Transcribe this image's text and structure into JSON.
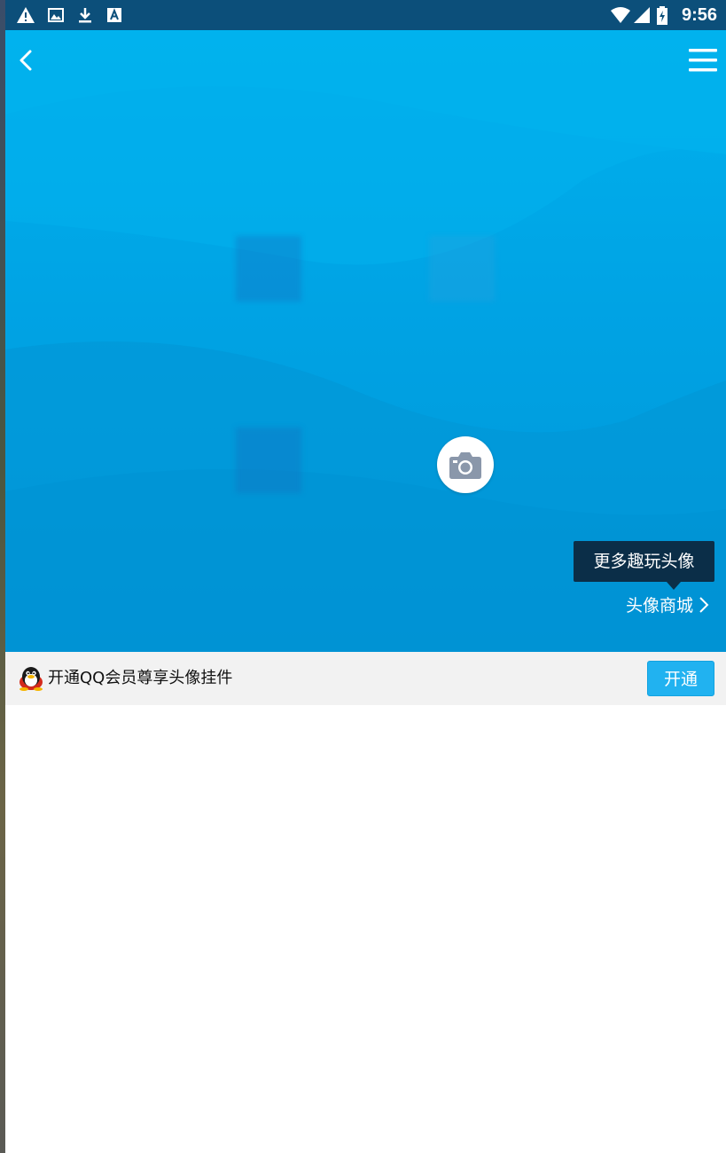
{
  "status_bar": {
    "icons_left": [
      "warning-icon",
      "image-icon",
      "download-icon",
      "font-icon"
    ],
    "icons_right": [
      "wifi-icon",
      "signal-icon",
      "battery-charging-icon"
    ],
    "time": "9:56"
  },
  "header": {
    "back_icon": "chevron-left-icon",
    "menu_icon": "menu-icon"
  },
  "hero": {
    "camera_icon": "camera-icon",
    "tooltip_text": "更多趣玩头像",
    "mall_link_label": "头像商城",
    "mall_link_icon": "chevron-right-icon"
  },
  "vip_banner": {
    "icon": "qq-penguin-icon",
    "text": "开通QQ会员尊享头像挂件",
    "button_label": "开通"
  },
  "colors": {
    "hero_blue": "#00a3e4",
    "status_bar": "#0c4f7a",
    "tooltip_bg": "#0b2e48",
    "button_blue": "#21b2f0"
  }
}
